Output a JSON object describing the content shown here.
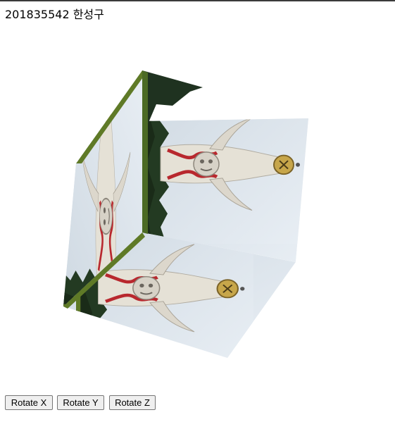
{
  "header": {
    "title": "201835542 한성구"
  },
  "controls": {
    "buttons": [
      {
        "label": "Rotate X"
      },
      {
        "label": "Rotate Y"
      },
      {
        "label": "Rotate Z"
      }
    ]
  },
  "colors": {
    "sky": "#dbe4ec",
    "tree_dark": "#24351f",
    "grass": "#5f7a27",
    "statue_white": "#e8e3d8",
    "statue_red": "#b8282e",
    "face_gold": "#c7a64a"
  }
}
